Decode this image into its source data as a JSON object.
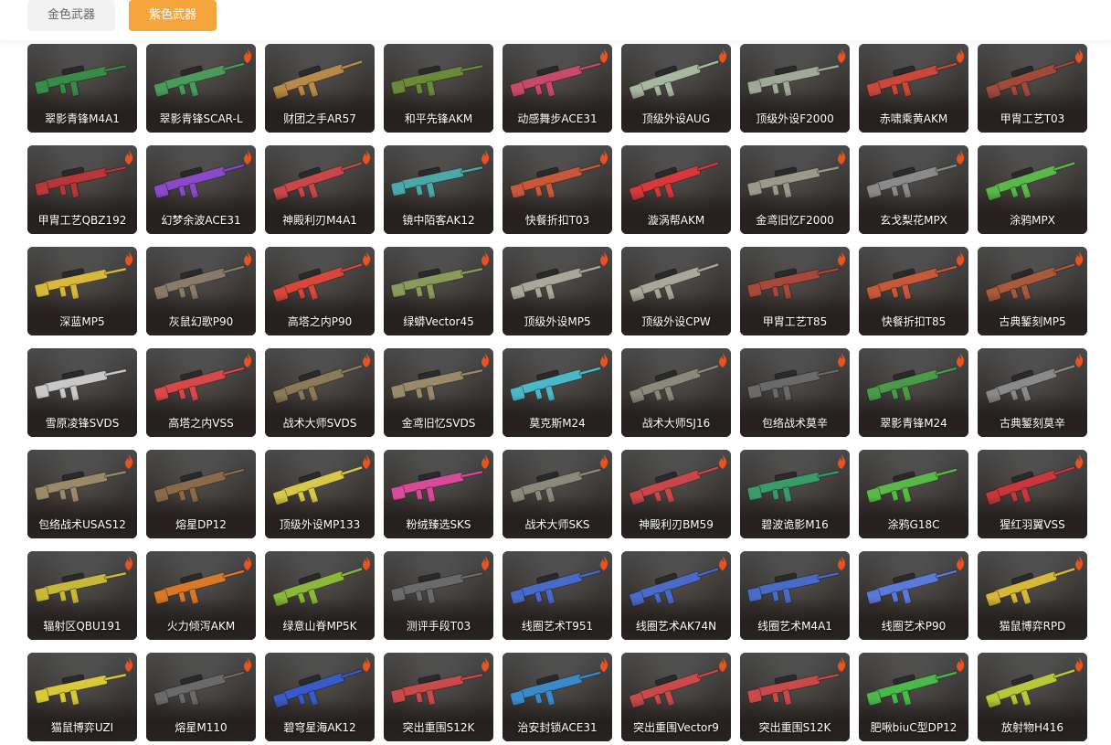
{
  "tabs": [
    {
      "label": "金色武器",
      "active": false
    },
    {
      "label": "紫色武器",
      "active": true
    }
  ],
  "colors": {
    "accent": "#f5a53b",
    "flame": "#e8531f",
    "card_bg": "#2b2523"
  },
  "weapons": [
    {
      "name": "翠影青锋M4A1",
      "color": "#3a8a48",
      "flame": false
    },
    {
      "name": "翠影青锋SCAR-L",
      "color": "#4a9a5a",
      "flame": true
    },
    {
      "name": "财团之手AR57",
      "color": "#b88a4a",
      "flame": false
    },
    {
      "name": "和平先锋AKM",
      "color": "#6a8a3a",
      "flame": false
    },
    {
      "name": "动感舞步ACE31",
      "color": "#c84a6a",
      "flame": true
    },
    {
      "name": "顶级外设AUG",
      "color": "#a8b8a0",
      "flame": true
    },
    {
      "name": "顶级外设F2000",
      "color": "#a0a898",
      "flame": true
    },
    {
      "name": "赤啸乘黄AKM",
      "color": "#c8483a",
      "flame": true
    },
    {
      "name": "甲胄工艺T03",
      "color": "#a04a3a",
      "flame": true
    },
    {
      "name": "甲胄工艺QBZ192",
      "color": "#b8383a",
      "flame": true
    },
    {
      "name": "幻梦余波ACE31",
      "color": "#8a4ac8",
      "flame": true
    },
    {
      "name": "神殿利刃M4A1",
      "color": "#c8484a",
      "flame": true
    },
    {
      "name": "镜中陌客AK12",
      "color": "#4aa8a8",
      "flame": true
    },
    {
      "name": "快餐折扣T03",
      "color": "#c8583a",
      "flame": true
    },
    {
      "name": "漩涡帮AKM",
      "color": "#d8383a",
      "flame": false
    },
    {
      "name": "金鸢旧忆F2000",
      "color": "#9a9a8a",
      "flame": true
    },
    {
      "name": "玄戈梨花MPX",
      "color": "#8a8a8a",
      "flame": true
    },
    {
      "name": "涂鸦MPX",
      "color": "#5ab84a",
      "flame": false
    },
    {
      "name": "深蓝MP5",
      "color": "#d8b83a",
      "flame": true
    },
    {
      "name": "灰鼠幻歌P90",
      "color": "#8a7a6a",
      "flame": true
    },
    {
      "name": "高塔之内P90",
      "color": "#d8483a",
      "flame": true
    },
    {
      "name": "绿蟒Vector45",
      "color": "#8a9a5a",
      "flame": true
    },
    {
      "name": "顶级外设MP5",
      "color": "#a8a898",
      "flame": true
    },
    {
      "name": "顶级外设CPW",
      "color": "#a8a898",
      "flame": false
    },
    {
      "name": "甲胄工艺T85",
      "color": "#a8483a",
      "flame": true
    },
    {
      "name": "快餐折扣T85",
      "color": "#c8583a",
      "flame": true
    },
    {
      "name": "古典錾刻MP5",
      "color": "#a85a3a",
      "flame": true
    },
    {
      "name": "雪原凌锋SVDS",
      "color": "#c8c8c8",
      "flame": false
    },
    {
      "name": "高塔之内VSS",
      "color": "#d8484a",
      "flame": true
    },
    {
      "name": "战术大师SVDS",
      "color": "#8a7a5a",
      "flame": true
    },
    {
      "name": "金鸢旧忆SVDS",
      "color": "#9a8a6a",
      "flame": true
    },
    {
      "name": "莫克斯M24",
      "color": "#4ab8c8",
      "flame": true
    },
    {
      "name": "战术大师SJ16",
      "color": "#8a8a7a",
      "flame": true
    },
    {
      "name": "包络战术莫辛",
      "color": "#6a6a6a",
      "flame": true
    },
    {
      "name": "翠影青锋M24",
      "color": "#4a9a4a",
      "flame": true
    },
    {
      "name": "古典錾刻莫辛",
      "color": "#8a8a8a",
      "flame": true
    },
    {
      "name": "包络战术USAS12",
      "color": "#9a8a6a",
      "flame": true
    },
    {
      "name": "熔星DP12",
      "color": "#8a6a4a",
      "flame": false
    },
    {
      "name": "顶级外设MP133",
      "color": "#d8c84a",
      "flame": true
    },
    {
      "name": "粉绒臻选SKS",
      "color": "#d84a9a",
      "flame": true
    },
    {
      "name": "战术大师SKS",
      "color": "#8a8a7a",
      "flame": true
    },
    {
      "name": "神殿利刃BM59",
      "color": "#c8484a",
      "flame": true
    },
    {
      "name": "碧波诡影M16",
      "color": "#3a9a6a",
      "flame": true
    },
    {
      "name": "涂鸦G18C",
      "color": "#5ab84a",
      "flame": false
    },
    {
      "name": "猩红羽翼VSS",
      "color": "#c8383a",
      "flame": true
    },
    {
      "name": "辐射区QBU191",
      "color": "#c8b83a",
      "flame": true
    },
    {
      "name": "火力倾泻AKM",
      "color": "#d8782a",
      "flame": true
    },
    {
      "name": "绿意山脊MP5K",
      "color": "#8ab83a",
      "flame": true
    },
    {
      "name": "测评手段T03",
      "color": "#6a6a6a",
      "flame": true
    },
    {
      "name": "线圈艺术T951",
      "color": "#4a6ac8",
      "flame": true
    },
    {
      "name": "线圈艺术AK74N",
      "color": "#4a6ac8",
      "flame": true
    },
    {
      "name": "线圈艺术M4A1",
      "color": "#4a6ac8",
      "flame": true
    },
    {
      "name": "线圈艺术P90",
      "color": "#5a7ad8",
      "flame": true
    },
    {
      "name": "猫鼠博弈RPD",
      "color": "#d8b83a",
      "flame": true
    },
    {
      "name": "猫鼠博弈UZI",
      "color": "#d8c83a",
      "flame": true
    },
    {
      "name": "熔星M110",
      "color": "#6a6a6a",
      "flame": true
    },
    {
      "name": "碧穹星海AK12",
      "color": "#3a5ac8",
      "flame": true
    },
    {
      "name": "突出重围S12K",
      "color": "#c84a4a",
      "flame": true
    },
    {
      "name": "治安封锁ACE31",
      "color": "#3a8ac8",
      "flame": true
    },
    {
      "name": "突出重围Vector9",
      "color": "#c84a4a",
      "flame": true
    },
    {
      "name": "突出重围S12K",
      "color": "#c84a4a",
      "flame": true
    },
    {
      "name": "肥啾biuC型DP12",
      "color": "#4ab84a",
      "flame": true
    },
    {
      "name": "放射物H416",
      "color": "#b8c83a",
      "flame": true
    }
  ]
}
